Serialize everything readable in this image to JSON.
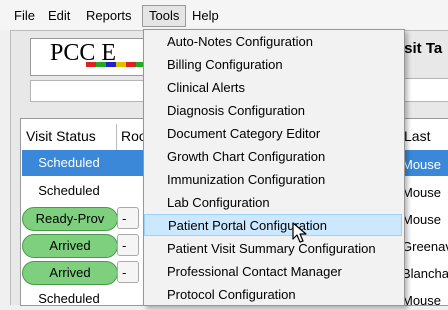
{
  "menubar": {
    "items": [
      "File",
      "Edit",
      "Reports",
      "Tools",
      "Help"
    ],
    "active": "Tools"
  },
  "header": {
    "logo_text": "PCC E",
    "right_title": "isit Ta"
  },
  "grid": {
    "columns": [
      "Visit Status",
      "Roo",
      "Last"
    ],
    "rows": [
      {
        "status": "Scheduled",
        "room": "",
        "last": "Mouse",
        "style": "selected"
      },
      {
        "status": "Scheduled",
        "room": "",
        "last": "Mouse",
        "style": "plain"
      },
      {
        "status": "Ready-Prov",
        "room": "-",
        "last": "Mouse",
        "style": "pill"
      },
      {
        "status": "Arrived",
        "room": "-",
        "last": "Greenav",
        "style": "pill"
      },
      {
        "status": "Arrived",
        "room": "-",
        "last": "Blanchar",
        "style": "pill"
      },
      {
        "status": "Scheduled",
        "room": "",
        "last": "Mouse",
        "style": "plain"
      }
    ]
  },
  "tools_menu": {
    "items": [
      "Auto-Notes Configuration",
      "Billing Configuration",
      "Clinical Alerts",
      "Diagnosis Configuration",
      "Document Category Editor",
      "Growth Chart Configuration",
      "Immunization Configuration",
      "Lab Configuration",
      "Patient Portal Configuration",
      "Patient Visit Summary Configuration",
      "Professional Contact Manager",
      "Protocol Configuration"
    ],
    "highlighted": "Patient Portal Configuration"
  },
  "colors": {
    "selection_blue": "#3b88d8",
    "pill_green": "#7ed07e",
    "menu_highlight": "#cce8ff"
  }
}
